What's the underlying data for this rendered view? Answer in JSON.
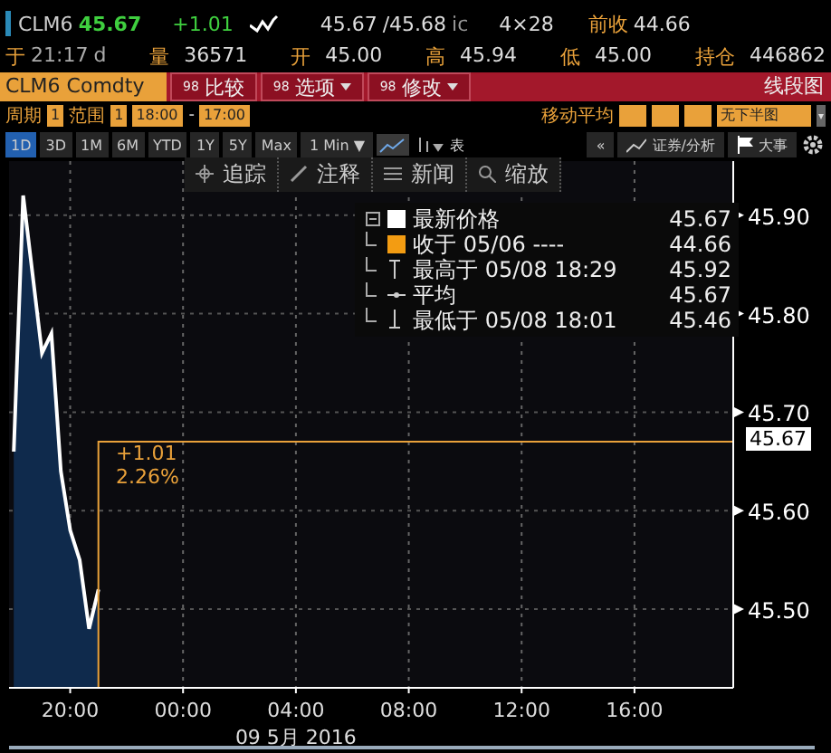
{
  "quote": {
    "ticker": "CLM6",
    "last": "45.67",
    "change": "+1.01",
    "bid": "45.67",
    "ask": "/45.68",
    "source": "ic",
    "size": "4×28",
    "prev_close": {
      "label": "前收",
      "value": "44.66"
    }
  },
  "time": {
    "label": "于",
    "value": "21:17",
    "suffix": "d"
  },
  "stats": [
    {
      "label": "量",
      "value": "36571"
    },
    {
      "label": "开",
      "value": "45.00"
    },
    {
      "label": "高",
      "value": "45.94"
    },
    {
      "label": "低",
      "value": "45.00"
    },
    {
      "label": "持仓",
      "value": "446862"
    }
  ],
  "toolbar": {
    "security": "CLM6 Comdty",
    "buttons": [
      {
        "code": "98",
        "label": "比较",
        "menu": false
      },
      {
        "code": "98",
        "label": "选项",
        "menu": true
      },
      {
        "code": "98",
        "label": "修改",
        "menu": true
      }
    ],
    "chart_type": "线段图"
  },
  "settings": {
    "period_label": "周期",
    "period": "1",
    "range_label": "范围",
    "range": "1",
    "start": "18:00",
    "dash": "-",
    "end": "17:00",
    "ma_label": "移动平均",
    "lower_chart": "无下半图"
  },
  "ranges": [
    {
      "label": "1D",
      "selected": true
    },
    {
      "label": "3D",
      "selected": false
    },
    {
      "label": "1M",
      "selected": false
    },
    {
      "label": "6M",
      "selected": false
    },
    {
      "label": "YTD",
      "selected": false
    },
    {
      "label": "1Y",
      "selected": false
    },
    {
      "label": "5Y",
      "selected": false
    },
    {
      "label": "Max",
      "selected": false
    }
  ],
  "interval": "1 Min ▼",
  "table_label": "表",
  "collapse": "«",
  "analysis": "证券/分析",
  "events": "大事",
  "chart_tools": [
    "追踪",
    "注释",
    "新闻",
    "缩放"
  ],
  "legend": [
    {
      "kind": "swatch",
      "color": "#ffffff",
      "label": "最新价格",
      "value": "45.67"
    },
    {
      "kind": "swatch",
      "color": "#f39c12",
      "label": "收于 05/06 ----",
      "value": "44.66"
    },
    {
      "kind": "high",
      "label": "最高于 05/08 18:29",
      "value": "45.92"
    },
    {
      "kind": "avg",
      "label": "平均",
      "value": "45.67"
    },
    {
      "kind": "low",
      "label": "最低于 05/08 18:01",
      "value": "45.46"
    }
  ],
  "change_box": {
    "change": "+1.01",
    "percent": "2.26%"
  },
  "last_price_label": "45.67",
  "date_label": "09 5月 2016",
  "chart_data": {
    "type": "area",
    "grid": true,
    "categories": [
      null,
      null,
      null,
      null,
      null,
      null,
      "20:00",
      null,
      null,
      null,
      null,
      null,
      null,
      null,
      null,
      null,
      null,
      null,
      "00:00",
      null,
      null,
      null,
      null,
      null,
      null,
      null,
      null,
      null,
      null,
      null,
      "04:00",
      null,
      null,
      null,
      null,
      null,
      null,
      null,
      null,
      null,
      null,
      null,
      "08:00",
      null,
      null,
      null,
      null,
      null,
      null,
      null,
      null,
      null,
      null,
      null,
      "12:00",
      null,
      null,
      null,
      null,
      null,
      null,
      null,
      null,
      null,
      null,
      null,
      "16:00",
      null,
      null,
      null,
      null,
      null,
      null,
      null,
      null,
      null,
      null
    ],
    "series": [
      {
        "color": "#ffffff",
        "values": [
          45.66,
          45.92,
          45.84,
          45.76,
          45.78,
          45.64,
          45.58,
          45.55,
          45.48,
          45.52,
          null,
          null,
          null,
          null,
          null,
          null,
          null,
          null,
          null,
          null,
          null,
          null,
          null,
          null,
          null,
          null,
          null,
          null,
          null,
          null,
          null,
          null,
          null,
          null,
          null,
          null,
          null,
          null,
          null,
          null,
          null,
          null,
          null,
          null,
          null,
          null,
          null,
          null,
          null,
          null,
          null,
          null,
          null,
          null,
          null,
          null,
          null,
          null,
          null,
          null,
          null,
          null,
          null,
          null,
          null,
          null,
          null,
          null,
          null,
          null,
          null,
          null,
          null,
          null,
          null,
          null,
          null
        ]
      }
    ],
    "ylim": [
      45.42,
      45.955
    ],
    "yticks": [
      {
        "value": 45.5,
        "label": "45.50"
      },
      {
        "value": 45.6,
        "label": "45.60"
      },
      {
        "value": 45.7,
        "label": "45.70"
      },
      {
        "value": 45.8,
        "label": "45.80"
      },
      {
        "value": 45.9,
        "label": "45.90"
      }
    ]
  }
}
